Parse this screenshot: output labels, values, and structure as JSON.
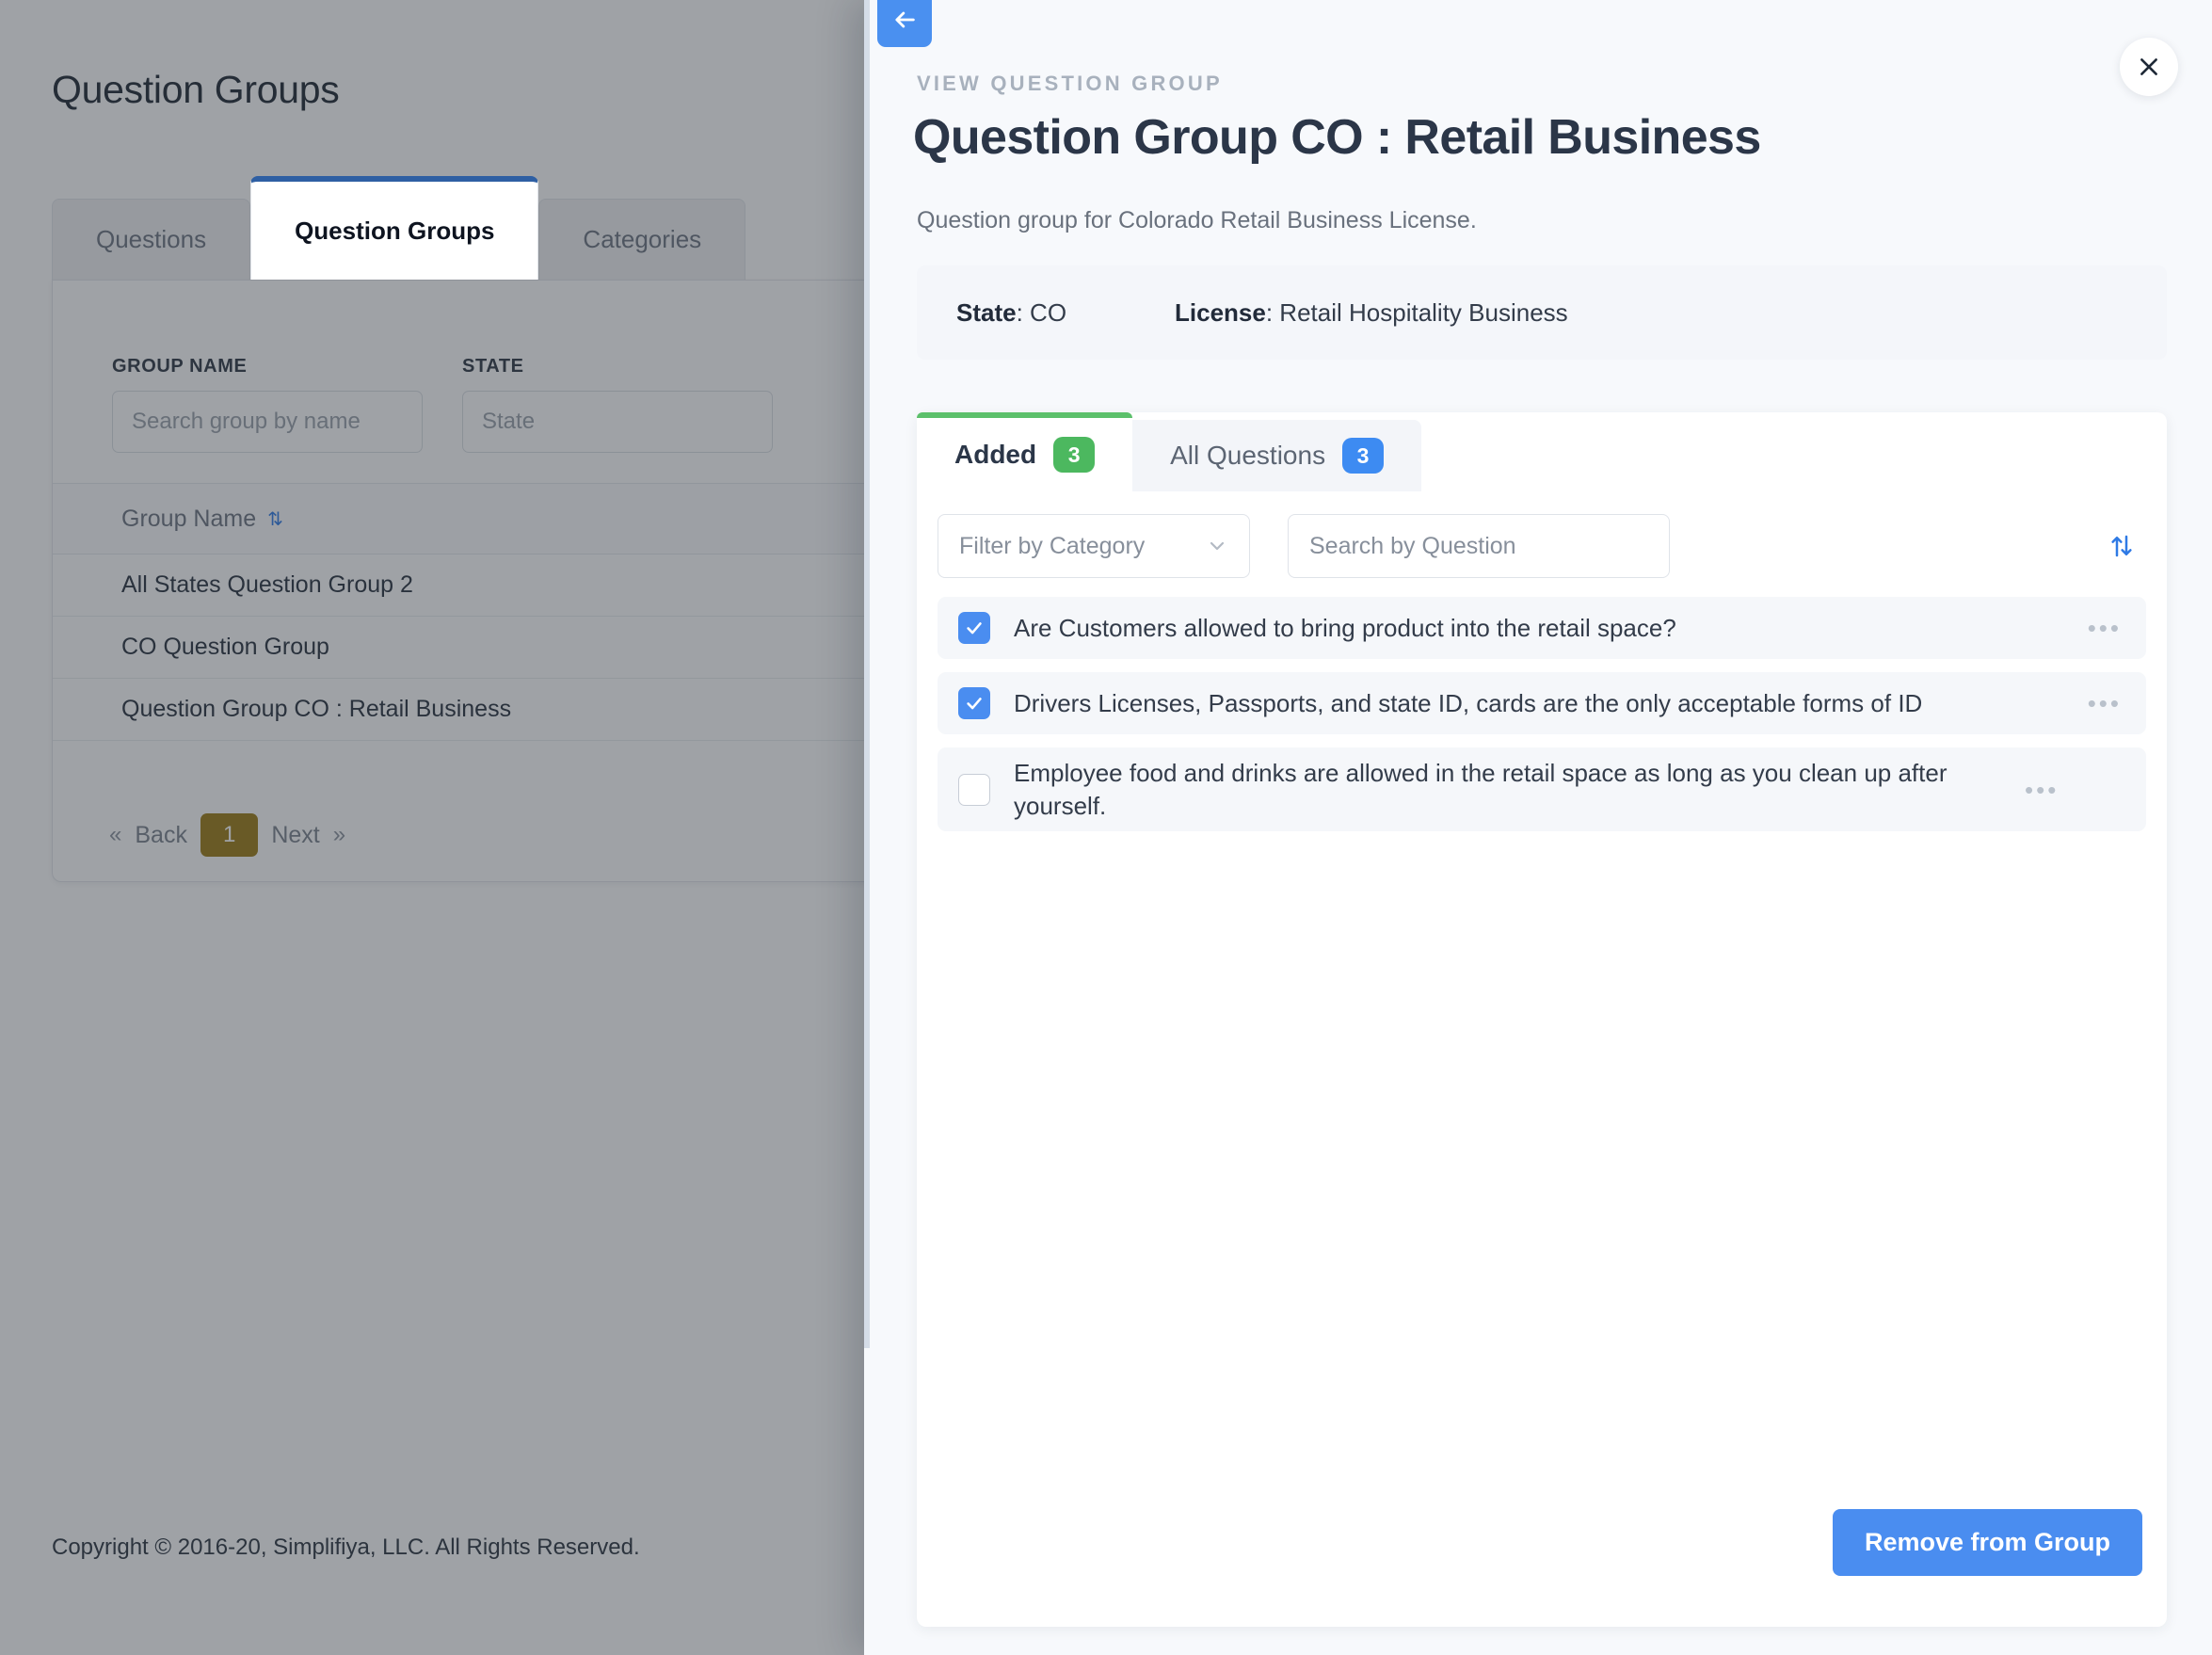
{
  "background": {
    "page_title": "Question Groups",
    "tabs": [
      {
        "label": "Questions",
        "active": false
      },
      {
        "label": "Question Groups",
        "active": true
      },
      {
        "label": "Categories",
        "active": false
      }
    ],
    "filters": {
      "group_name_label": "GROUP NAME",
      "group_name_placeholder": "Search group by name",
      "state_label": "STATE",
      "state_placeholder": "State"
    },
    "table": {
      "column_header": "Group Name",
      "sort_icon": "sort-updown-icon",
      "rows": [
        "All States Question Group 2",
        "CO Question Group",
        "Question Group CO : Retail Business"
      ]
    },
    "pagination": {
      "first": "«",
      "back": "Back",
      "current_page": "1",
      "next": "Next",
      "last": "»"
    },
    "footer": "Copyright © 2016-20, Simplifiya, LLC. All Rights Reserved."
  },
  "drawer": {
    "back_icon": "arrow-left-icon",
    "close_icon": "close-icon",
    "eyebrow": "VIEW QUESTION GROUP",
    "title": "Question Group CO : Retail Business",
    "subtitle": "Question group for Colorado Retail Business License.",
    "meta": {
      "state_label": "State",
      "state_value": "CO",
      "license_label": "License",
      "license_value": "Retail Hospitality Business",
      "separator": ":"
    },
    "tabs": [
      {
        "label": "Added",
        "count": "3",
        "active": true,
        "badge_color": "#4cb85f"
      },
      {
        "label": "All Questions",
        "count": "3",
        "active": false,
        "badge_color": "#3d8bf2"
      }
    ],
    "filters": {
      "category_placeholder": "Filter by Category",
      "category_chevron": "chevron-down-icon",
      "search_placeholder": "Search by Question",
      "sort_icon": "sort-updown-icon"
    },
    "questions": [
      {
        "text": "Are Customers allowed to bring product into the retail space?",
        "checked": true,
        "menu_icon": "ellipsis-icon"
      },
      {
        "text": "Drivers Licenses, Passports, and state ID, cards are the only acceptable forms of ID",
        "checked": true,
        "menu_icon": "ellipsis-icon"
      },
      {
        "text": "Employee food and drinks are allowed in the retail space as long as you clean up after yourself.",
        "checked": false,
        "menu_icon": "ellipsis-icon"
      }
    ],
    "primary_action": "Remove from Group"
  },
  "colors": {
    "accent_blue": "#4a8df0",
    "accent_green": "#4cb85f",
    "tab_active_underline": "#2e5fa3",
    "pagination_active": "#9c7a14"
  }
}
